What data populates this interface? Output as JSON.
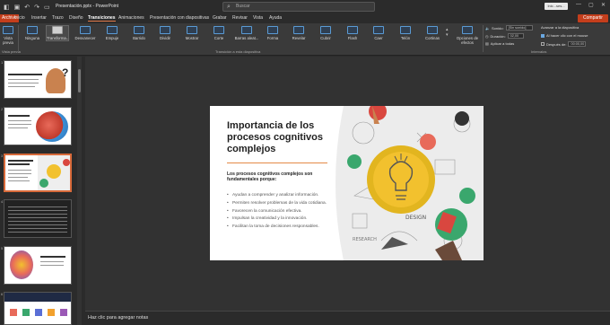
{
  "window": {
    "doc_title": "Presentación.pptx  -  PowerPoint",
    "search_placeholder": "Buscar",
    "user_label": "Inic...ses..."
  },
  "menu": {
    "tabs": [
      "Archivo",
      "Inicio",
      "Insertar",
      "Trazo",
      "Diseño",
      "Transiciones",
      "Animaciones",
      "Presentación con diapositivas",
      "Grabar",
      "Revisar",
      "Vista",
      "Ayuda"
    ],
    "active": "Transiciones",
    "share_label": "Compartir"
  },
  "ribbon": {
    "preview_label": "Vista previa",
    "preview_group_label": "Vista previa",
    "transitions": [
      "Ninguna",
      "Transforma...",
      "Desvanecer",
      "Empuje",
      "Barrido",
      "Dividir",
      "Mostrar",
      "Corte",
      "Barras aleat...",
      "Forma",
      "Revelar",
      "Cubrir",
      "Flash",
      "Caer",
      "Telón",
      "Cortinas"
    ],
    "selected_transition": "Transforma...",
    "effects_label": "Opciones de efectos",
    "transition_group_label": "Transición a esta diapositiva",
    "sound_label": "Sonido:",
    "sound_value": "[Sin sonido]",
    "duration_label": "Duración:",
    "duration_value": "02,00",
    "apply_all_label": "Aplicar a todas",
    "advance_label": "Avanzar a la diapositiva",
    "on_click_label": "Al hacer clic con el mouse",
    "after_label": "Después de:",
    "after_value": "00:00,00",
    "timing_group_label": "Intervalos"
  },
  "slides": [
    {
      "num": "1"
    },
    {
      "num": "2"
    },
    {
      "num": "3"
    },
    {
      "num": "4"
    },
    {
      "num": "5"
    },
    {
      "num": "6"
    }
  ],
  "active_slide": "3",
  "slide": {
    "title": "Importancia de los procesos cognitivos complejos",
    "intro": "Los procesos cognitivos complejos son fundamentales porque:",
    "bullets": [
      "Ayudan a comprender y analizar información.",
      "Permiten resolver problemas de la vida cotidiana.",
      "Favorecen la comunicación efectiva.",
      "Impulsan la creatividad y la innovación.",
      "Facilitan la toma de decisiones responsables."
    ],
    "art_words": [
      "DESIGN",
      "RESEARCH"
    ]
  },
  "notes": {
    "placeholder": "Haz clic para agregar notas"
  },
  "colors": {
    "accent": "#d86a3a",
    "share": "#c43e1c",
    "slide_rule": "#e48a48"
  }
}
